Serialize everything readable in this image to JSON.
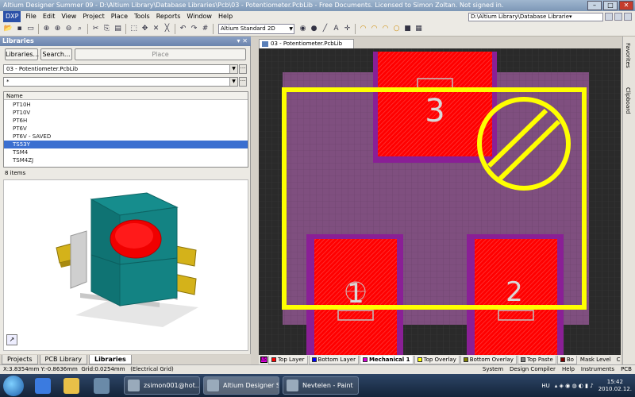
{
  "window": {
    "title": "Altium Designer Summer 09 - D:\\Altium Library\\Database Libraries\\Pcb\\03 - Potentiometer.PcbLib - Free Documents. Licensed to Simon Zoltan. Not signed in.",
    "path": "D:\\Altium Library\\Database Librarie▾"
  },
  "menu": [
    "DXP",
    "File",
    "Edit",
    "View",
    "Project",
    "Place",
    "Tools",
    "Reports",
    "Window",
    "Help"
  ],
  "toolbar": {
    "view_mode": "Altium Standard 2D"
  },
  "panel": {
    "title": "Libraries",
    "libraries_button": "Libraries...",
    "search_button": "Search...",
    "place_button": "Place",
    "library": "03 - Potentiometer.PcbLib",
    "filter": "*",
    "list_header": "Name",
    "items": [
      "PT10H",
      "PT10V",
      "PT6H",
      "PT6V",
      "PT6V - SAVED",
      "TS53Y",
      "TSM4",
      "TSM4ZJ"
    ],
    "selected_index": 5,
    "count": "8 items"
  },
  "panel_tabs": [
    "Projects",
    "PCB Library",
    "Libraries"
  ],
  "active_panel_tab": "Libraries",
  "document_tab": "03 - Potentiometer.PcbLib",
  "right_tabs": [
    "Favorites",
    "Clipboard"
  ],
  "footprint": {
    "pads": [
      "3",
      "1",
      "2"
    ],
    "colors": {
      "background": "#2a2a2a",
      "board": "#7f4f7f",
      "pad": "#ff0000",
      "solder_mask": "#8a1f96",
      "overlay": "#ffff00",
      "paste": "#c0c0c0",
      "text": "#c8c8c8"
    }
  },
  "layers": {
    "ls": "LS",
    "tabs": [
      {
        "label": "Top Layer",
        "color": "#ff0000"
      },
      {
        "label": "Bottom Layer",
        "color": "#0000ff"
      },
      {
        "label": "Mechanical 1",
        "color": "#d800d8"
      },
      {
        "label": "Top Overlay",
        "color": "#ffff00"
      },
      {
        "label": "Bottom Overlay",
        "color": "#808000"
      },
      {
        "label": "Top Paste",
        "color": "#808080"
      },
      {
        "label": "Bo",
        "color": "#800000"
      }
    ],
    "mask_level": "Mask Level",
    "clear": "Clear"
  },
  "status": {
    "coords": "X:3.8354mm Y:-0.8636mm",
    "grid": "Grid:0.0254mm",
    "grid_type": "(Electrical Grid)",
    "buttons": [
      "System",
      "Design Compiler",
      "Help",
      "Instruments",
      "PCB"
    ]
  },
  "taskbar": {
    "tasks": [
      "zsimon001@hot...",
      "Altium Designer S...",
      "Nevtelen - Paint"
    ],
    "lang": "HU",
    "time": "15:42",
    "date": "2010.02.12."
  }
}
